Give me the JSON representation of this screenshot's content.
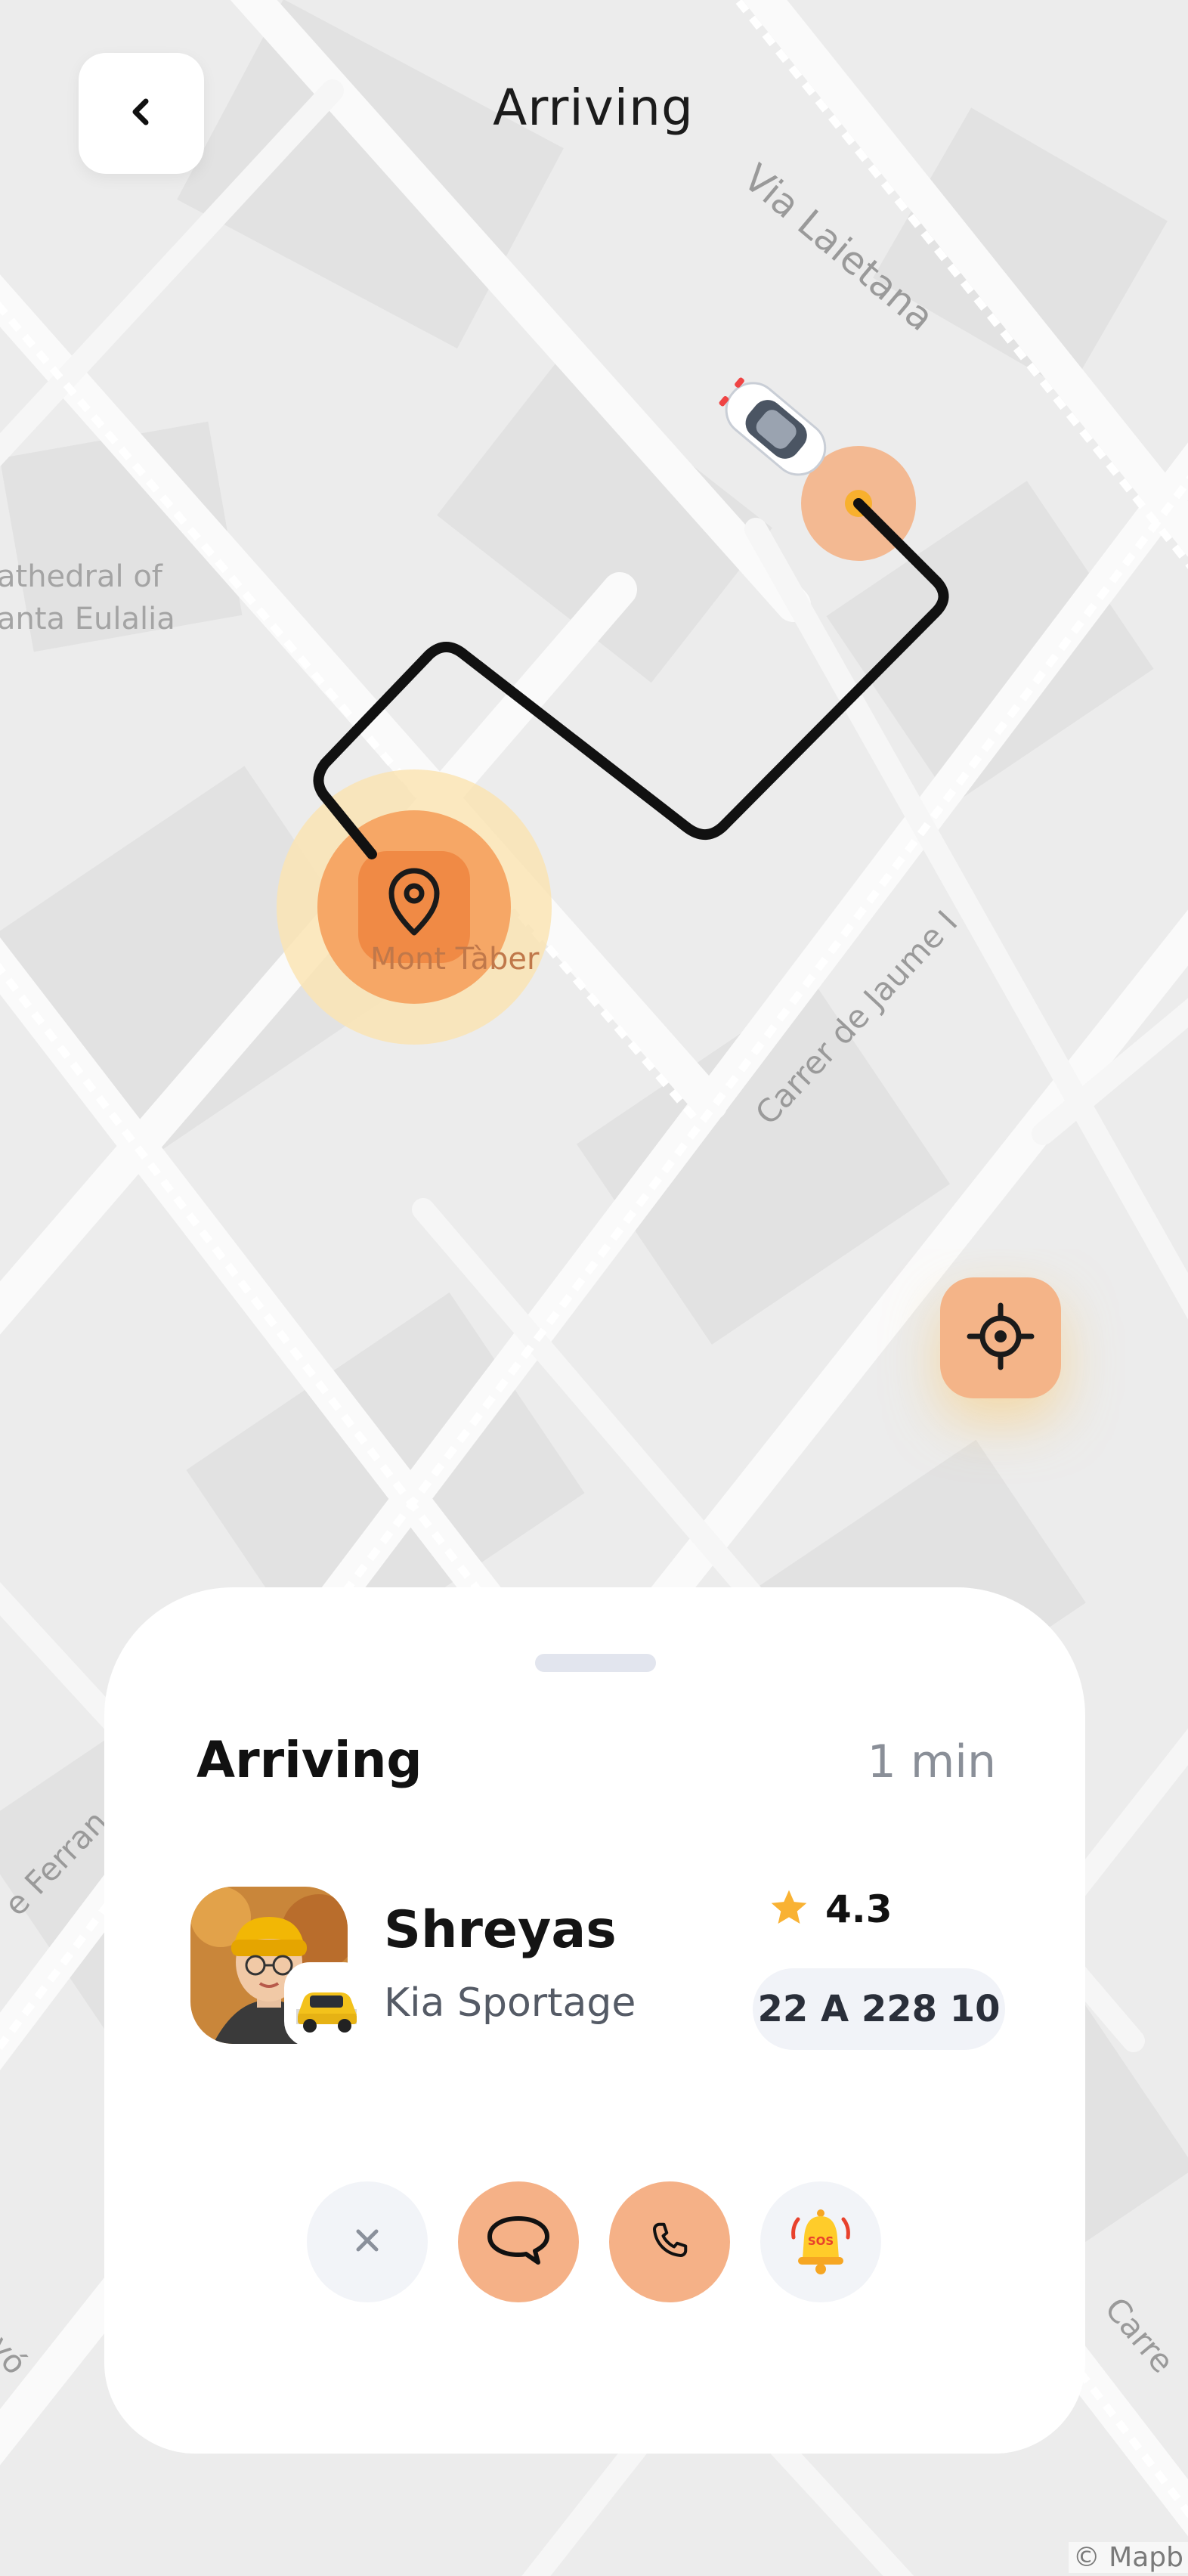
{
  "header": {
    "title": "Arriving"
  },
  "map": {
    "labels": {
      "cathedral_line1": "athedral of",
      "cathedral_line2": "anta Eulalia",
      "place": "Mont Tàber",
      "street_via_laietana": "Via Laietana",
      "street_jaume": "Carrer de Jaume I",
      "street_ferran": "e Ferran",
      "street_left_bottom": "nyó",
      "street_right_bottom": "Carre"
    },
    "attribution": "© Mapb"
  },
  "trip": {
    "status": "Arriving",
    "eta": "1 min"
  },
  "driver": {
    "name": "Shreyas",
    "car_model": "Kia Sportage",
    "rating": "4.3",
    "plate": "22 A 228 10"
  },
  "actions": {
    "sos_label": "SOS"
  },
  "colors": {
    "accent": "#F5B187",
    "accent_dark": "#F08A45",
    "route": "#111111",
    "star": "#F9B233"
  },
  "icons": {
    "back": "chevron-left-icon",
    "locate": "crosshair-icon",
    "cancel": "close-icon",
    "message": "chat-bubble-icon",
    "call": "phone-icon",
    "sos": "alarm-bell-icon",
    "rating": "star-icon",
    "destination": "map-pin-icon"
  }
}
